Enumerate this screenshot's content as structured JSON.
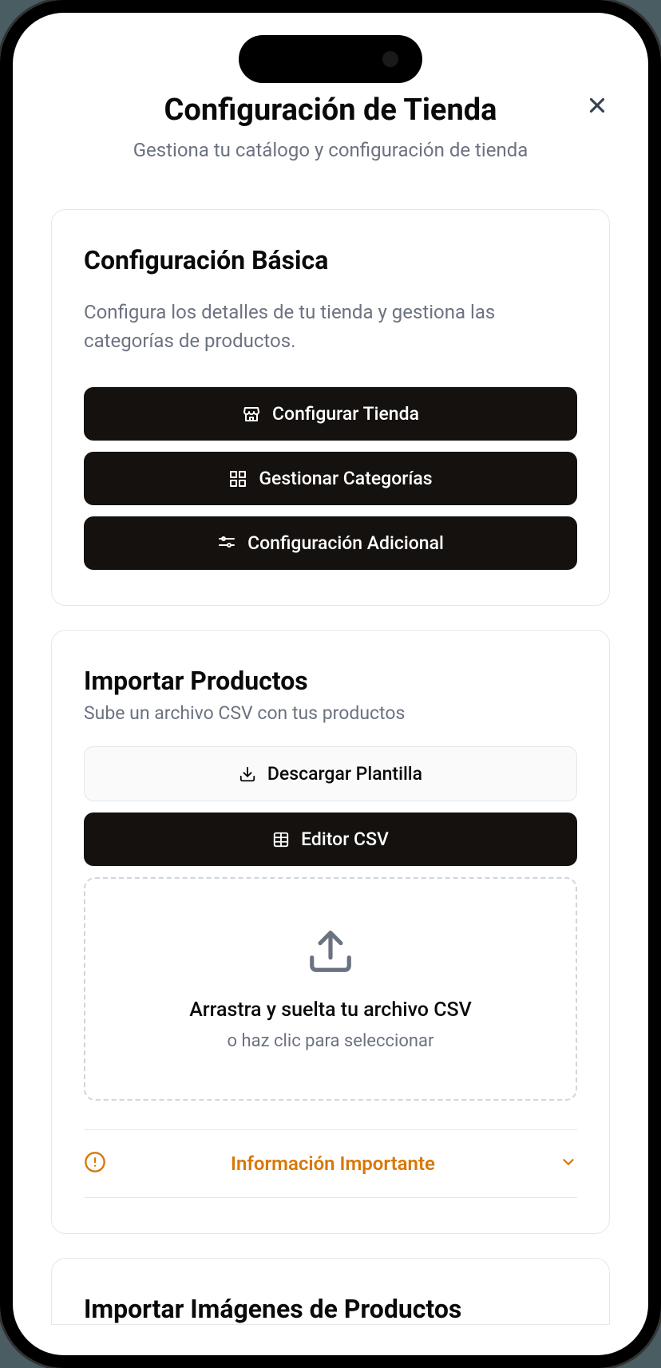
{
  "header": {
    "title": "Configuración de Tienda",
    "subtitle": "Gestiona tu catálogo y configuración de tienda"
  },
  "basic_config": {
    "title": "Configuración Básica",
    "description": "Configura los detalles de tu tienda y gestiona las categorías de productos.",
    "buttons": {
      "store": "Configurar Tienda",
      "categories": "Gestionar Categorías",
      "additional": "Configuración Adicional"
    }
  },
  "import_products": {
    "title": "Importar Productos",
    "subtitle": "Sube un archivo CSV con tus productos",
    "download_template": "Descargar Plantilla",
    "csv_editor": "Editor CSV",
    "dropzone": {
      "title": "Arrastra y suelta tu archivo CSV",
      "subtitle": "o haz clic para seleccionar"
    },
    "accordion": {
      "title": "Información Importante"
    }
  },
  "import_images": {
    "title": "Importar Imágenes de Productos"
  }
}
